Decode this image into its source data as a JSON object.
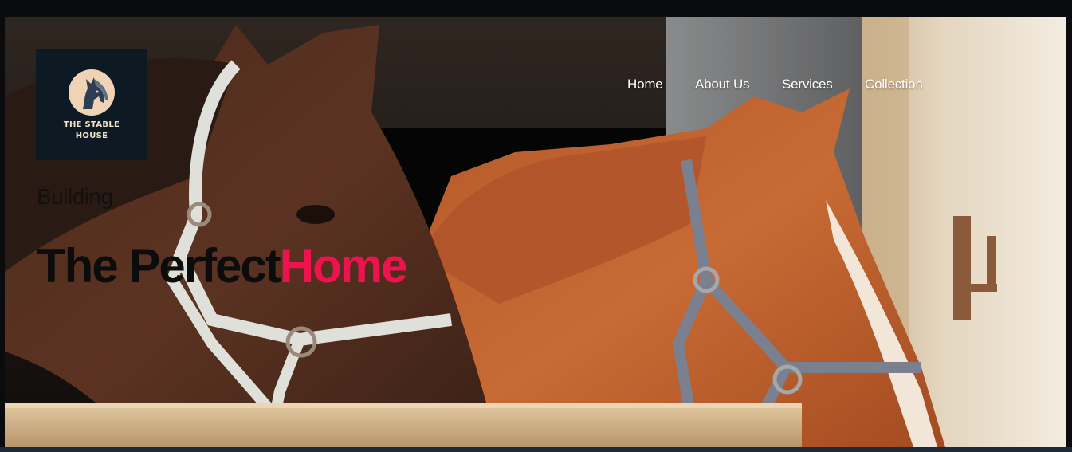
{
  "logo": {
    "line1": "THE STABLE",
    "line2": "HOUSE",
    "emblem_icon": "horse-head-icon",
    "background_color": "#0d1a24"
  },
  "nav": {
    "items": [
      {
        "label": "Home"
      },
      {
        "label": "About Us"
      },
      {
        "label": "Services"
      },
      {
        "label": "Collection"
      }
    ]
  },
  "hero": {
    "kicker": "Building",
    "headline_dark": "The Perfect",
    "headline_accent": "Home",
    "accent_color": "#f0124f",
    "image_subject": "horse-pair-photo"
  }
}
